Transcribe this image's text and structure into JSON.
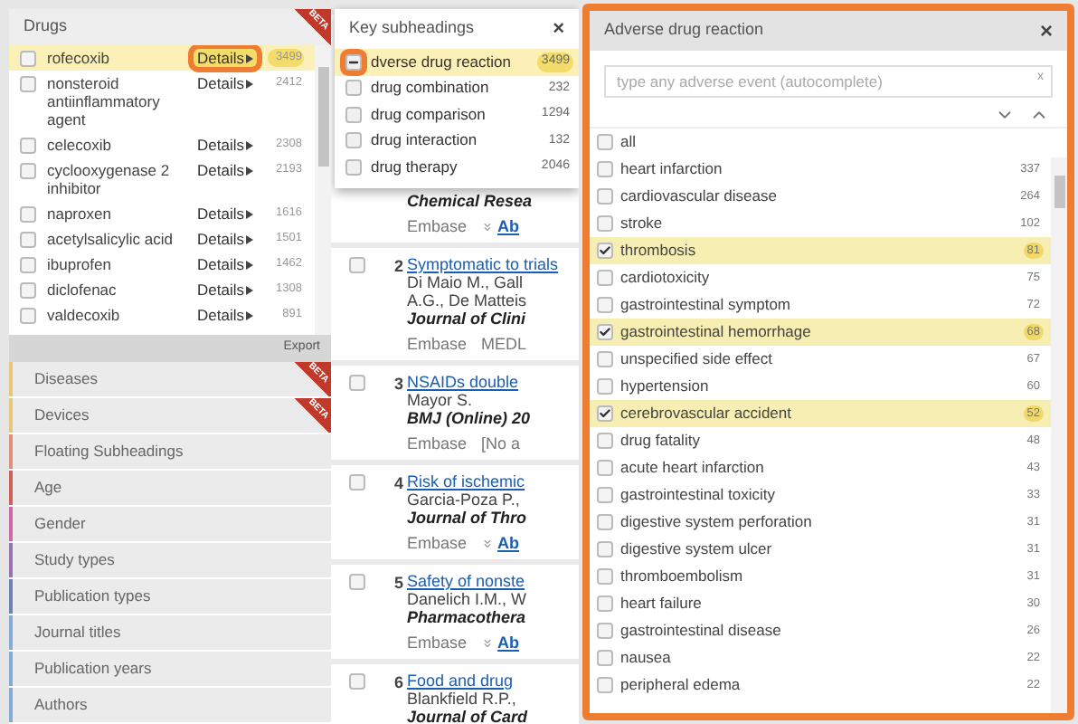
{
  "drugs_panel": {
    "title": "Drugs",
    "badge": "BETA",
    "items": [
      {
        "name": "rofecoxib",
        "details": "Details",
        "count": "3499",
        "selected": true,
        "callout": true
      },
      {
        "name": "nonsteroid antiinflammatory agent",
        "details": "Details",
        "count": "2412",
        "selected": false,
        "callout": false
      },
      {
        "name": "celecoxib",
        "details": "Details",
        "count": "2308",
        "selected": false,
        "callout": false
      },
      {
        "name": "cyclooxygenase 2 inhibitor",
        "details": "Details",
        "count": "2193",
        "selected": false,
        "callout": false
      },
      {
        "name": "naproxen",
        "details": "Details",
        "count": "1616",
        "selected": false,
        "callout": false
      },
      {
        "name": "acetylsalicylic acid",
        "details": "Details",
        "count": "1501",
        "selected": false,
        "callout": false
      },
      {
        "name": "ibuprofen",
        "details": "Details",
        "count": "1462",
        "selected": false,
        "callout": false
      },
      {
        "name": "diclofenac",
        "details": "Details",
        "count": "1308",
        "selected": false,
        "callout": false
      },
      {
        "name": "valdecoxib",
        "details": "Details",
        "count": "891",
        "selected": false,
        "callout": false
      }
    ],
    "export": "Export"
  },
  "facets": [
    {
      "label": "Diseases",
      "color": "#e8c67a",
      "badge": "BETA"
    },
    {
      "label": "Devices",
      "color": "#e8c67a",
      "badge": "BETA"
    },
    {
      "label": "Floating Subheadings",
      "color": "#e0907a"
    },
    {
      "label": "Age",
      "color": "#d0605a"
    },
    {
      "label": "Gender",
      "color": "#d068a8"
    },
    {
      "label": "Study types",
      "color": "#9a72b2"
    },
    {
      "label": "Publication types",
      "color": "#7080b0"
    },
    {
      "label": "Journal titles",
      "color": "#84acd2"
    },
    {
      "label": "Publication years",
      "color": "#84acd2"
    },
    {
      "label": "Authors",
      "color": "#84acd2"
    }
  ],
  "key_subheadings": {
    "title": "Key subheadings",
    "close": "×",
    "items": [
      {
        "name": "dverse drug reaction",
        "count": "3499",
        "partial": true,
        "selected": true,
        "callout": true
      },
      {
        "name": "drug combination",
        "count": "232",
        "partial": false,
        "selected": false,
        "callout": false
      },
      {
        "name": "drug comparison",
        "count": "1294",
        "partial": false,
        "selected": false,
        "callout": false
      },
      {
        "name": "drug interaction",
        "count": "132",
        "partial": false,
        "selected": false,
        "callout": false
      },
      {
        "name": "drug therapy",
        "count": "2046",
        "partial": false,
        "selected": false,
        "callout": false
      }
    ]
  },
  "results": [
    {
      "journal": "Chemical Resea",
      "footer": [
        {
          "kind": "plain",
          "text": "Embase"
        },
        {
          "kind": "link",
          "text": "Ab"
        }
      ]
    },
    {
      "number": "2",
      "checked": false,
      "title": [
        "Symptomatic to",
        "trials"
      ],
      "authors": [
        "Di Maio M., Gall",
        "A.G., De Matteis"
      ],
      "journal": "Journal of Clini",
      "footer": [
        {
          "kind": "plain",
          "text": "Embase"
        },
        {
          "kind": "plain",
          "text": "MEDL"
        }
      ]
    },
    {
      "number": "3",
      "checked": false,
      "title": [
        "NSAIDs double"
      ],
      "authors": [
        "Mayor S."
      ],
      "journal": "BMJ (Online) 20",
      "footer": [
        {
          "kind": "plain",
          "text": "Embase"
        },
        {
          "kind": "plain",
          "text": "[No a"
        }
      ]
    },
    {
      "number": "4",
      "checked": false,
      "title": [
        "Risk of ischemic"
      ],
      "authors": [
        "Garcia-Poza P.,"
      ],
      "journal": "Journal of Thro",
      "footer": [
        {
          "kind": "plain",
          "text": "Embase"
        },
        {
          "kind": "link",
          "text": "Ab"
        }
      ]
    },
    {
      "number": "5",
      "checked": false,
      "title": [
        "Safety of nonste"
      ],
      "authors": [
        "Danelich I.M., W"
      ],
      "journal": "Pharmacothera",
      "footer": [
        {
          "kind": "plain",
          "text": "Embase"
        },
        {
          "kind": "link",
          "text": "Ab"
        }
      ]
    },
    {
      "number": "6",
      "checked": false,
      "title": [
        "Food and drug"
      ],
      "authors": [
        "Blankfield R.P.,"
      ],
      "journal": "Journal of Card"
    }
  ],
  "adverse_panel": {
    "title": "Adverse drug reaction",
    "close": "×",
    "callout": true,
    "search": {
      "placeholder": "type any adverse event (autocomplete)",
      "clear": "x"
    },
    "items": [
      {
        "name": "all",
        "checked": false
      },
      {
        "name": "heart infarction",
        "count": "337",
        "checked": false
      },
      {
        "name": "cardiovascular disease",
        "count": "264",
        "checked": false
      },
      {
        "name": "stroke",
        "count": "102",
        "checked": false
      },
      {
        "name": "thrombosis",
        "count": "81",
        "checked": true
      },
      {
        "name": "cardiotoxicity",
        "count": "75",
        "checked": false
      },
      {
        "name": "gastrointestinal symptom",
        "count": "72",
        "checked": false
      },
      {
        "name": "gastrointestinal hemorrhage",
        "count": "68",
        "checked": true
      },
      {
        "name": "unspecified side effect",
        "count": "67",
        "checked": false
      },
      {
        "name": "hypertension",
        "count": "60",
        "checked": false
      },
      {
        "name": "cerebrovascular accident",
        "count": "52",
        "checked": true
      },
      {
        "name": "drug fatality",
        "count": "48",
        "checked": false
      },
      {
        "name": "acute heart infarction",
        "count": "43",
        "checked": false
      },
      {
        "name": "gastrointestinal toxicity",
        "count": "33",
        "checked": false
      },
      {
        "name": "digestive system perforation",
        "count": "31",
        "checked": false
      },
      {
        "name": "digestive system ulcer",
        "count": "31",
        "checked": false
      },
      {
        "name": "thromboembolism",
        "count": "31",
        "checked": false
      },
      {
        "name": "heart failure",
        "count": "30",
        "checked": false
      },
      {
        "name": "gastrointestinal disease",
        "count": "26",
        "checked": false
      },
      {
        "name": "nausea",
        "count": "22",
        "checked": false
      },
      {
        "name": "peripheral edema",
        "count": "22",
        "checked": false
      }
    ]
  }
}
